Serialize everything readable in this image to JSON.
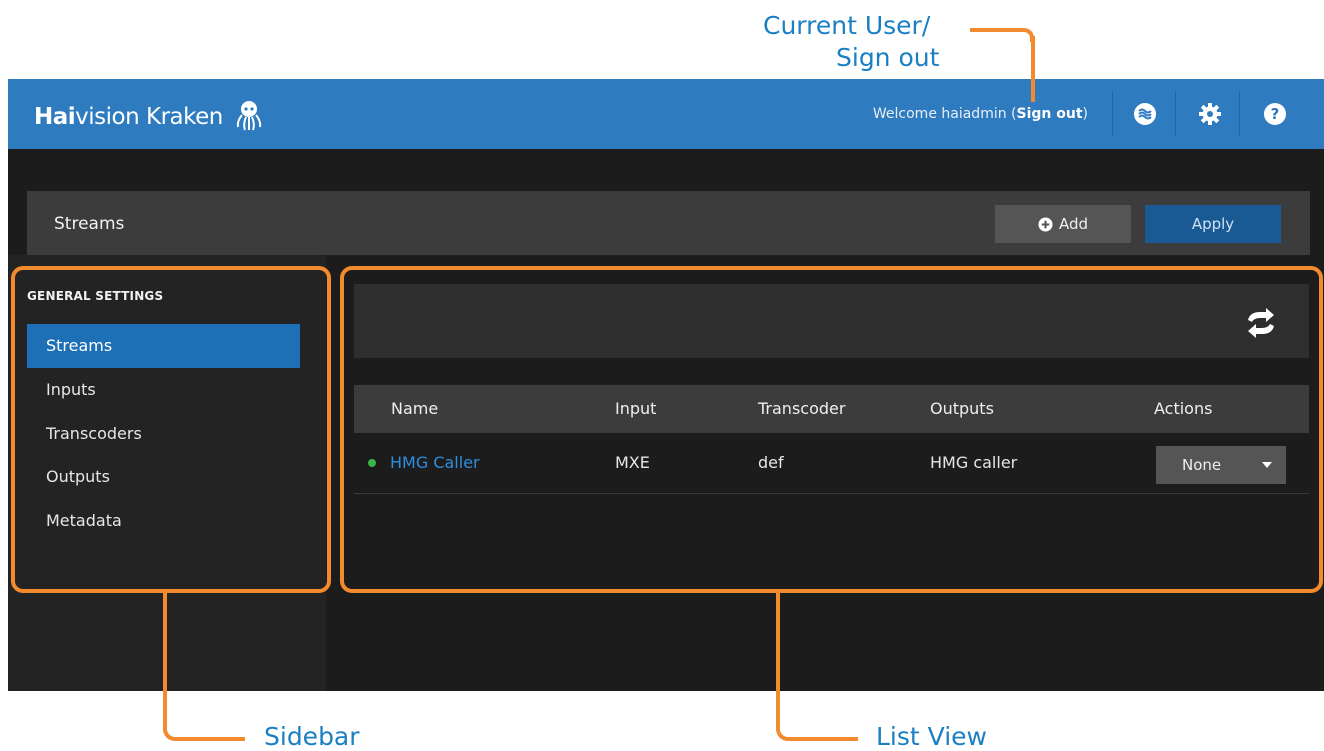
{
  "annotations": {
    "current_user_line1": "Current User/",
    "current_user_line2": "Sign out",
    "sidebar": "Sidebar",
    "list_view": "List View"
  },
  "topbar": {
    "brand_bold": "Hai",
    "brand_rest": "vision Kraken",
    "welcome_prefix": "Welcome haiadmin (",
    "sign_out": "Sign out",
    "welcome_suffix": ")",
    "icons": [
      "status-icon",
      "gear-icon",
      "help-icon"
    ]
  },
  "header": {
    "title": "Streams",
    "add_label": "Add",
    "apply_label": "Apply"
  },
  "sidebar": {
    "heading": "GENERAL SETTINGS",
    "items": [
      {
        "label": "Streams",
        "active": true
      },
      {
        "label": "Inputs"
      },
      {
        "label": "Transcoders"
      },
      {
        "label": "Outputs"
      },
      {
        "label": "Metadata"
      }
    ]
  },
  "table": {
    "columns": [
      "Name",
      "Input",
      "Transcoder",
      "Outputs",
      "Actions"
    ],
    "rows": [
      {
        "name": "HMG Caller",
        "input": "MXE",
        "transcoder": "def",
        "outputs": "HMG caller",
        "action": "None",
        "status": "online"
      }
    ]
  },
  "colors": {
    "brand": "#2e7bbf",
    "accent": "#1d6fb6",
    "annotation": "#1b7fc4",
    "callout": "#f28a2e",
    "status_ok": "#3ab54a"
  }
}
